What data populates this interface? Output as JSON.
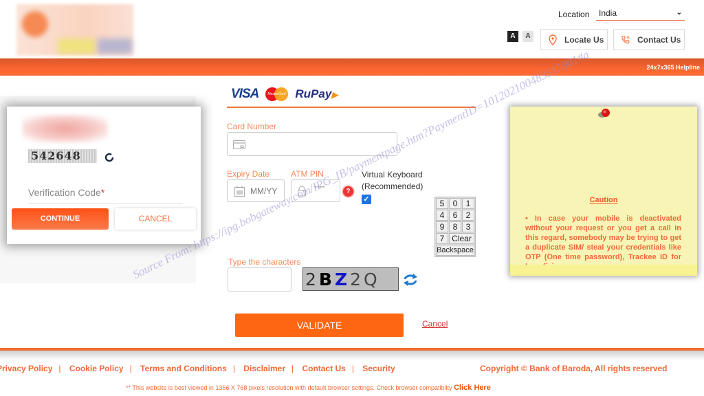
{
  "header": {
    "location_label": "Location",
    "location_value": "India",
    "font_size_dark": "A",
    "font_size_light": "A",
    "locate_us": "Locate Us",
    "contact_us": "Contact Us",
    "helpline": "24x7x365 Helpline"
  },
  "modal": {
    "captcha_code": "542648",
    "verification_placeholder": "Verification Code",
    "required_marker": "*",
    "continue": "CONTINUE",
    "cancel": "CANCEL"
  },
  "payment_form": {
    "card_brands": [
      "VISA",
      "MasterCard",
      "RuPay"
    ],
    "card_number_label": "Card Number",
    "card_number_value": "",
    "expiry_label": "Expiry Date",
    "expiry_placeholder": "MM/YY",
    "atm_pin_label": "ATM PIN",
    "atm_pin_placeholder": "****",
    "help_glyph": "?",
    "virtual_keyboard_label": "Virtual Keyboard",
    "virtual_keyboard_note": "(Recommended)",
    "virtual_keyboard_checked": true,
    "keypad": [
      "5",
      "0",
      "1",
      "4",
      "6",
      "2",
      "9",
      "8",
      "3",
      "7",
      "Clear",
      "Backspace"
    ],
    "captcha_label": "Type the characters",
    "captcha_value": "",
    "captcha_chars": [
      "2",
      "B",
      "Z",
      "2",
      "Q"
    ],
    "validate": "VALIDATE",
    "cancel_link": "Cancel"
  },
  "caution": {
    "title": "Caution",
    "text": "• In case your mobile is deactivated without your request or you get a call in this regard, somebody may be trying to get a duplicate SIM/ steal your credentials like OTP (One time password), Trackee ID for beneficiary"
  },
  "footer": {
    "links": [
      "Privacy Policy",
      "Cookie Policy",
      "Terms and Conditions",
      "Disclaimer",
      "Contact Us",
      "Security"
    ],
    "copyright": "Copyright © Bank of Baroda, All rights reserved",
    "note": "** This website is best viewed in 1366 X 768 pixels resolution with default browser settings. Check browser compatibilty",
    "note_link": "Click Here"
  },
  "watermark": "Source From: https://ipg.bobgateway.com/IPG_IB/paymentpage.htm?PaymentID=101202100483515901#a",
  "colors": {
    "brand_orange": "#fb6530",
    "label_orange": "#f5895b",
    "note_yellow": "#f7f4b5"
  }
}
